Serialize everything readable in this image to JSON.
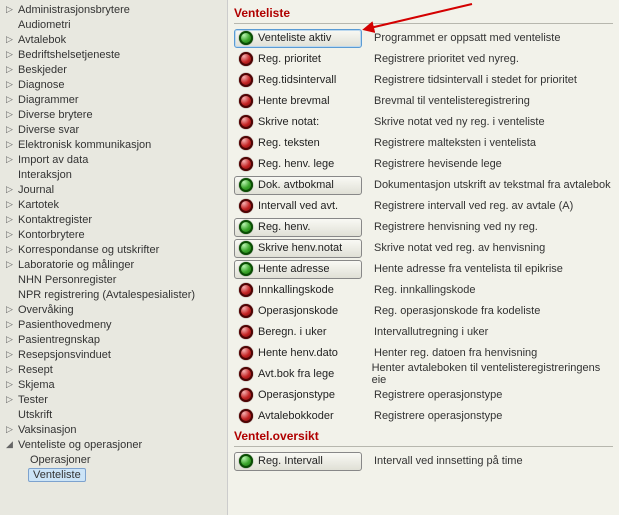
{
  "sidebar": {
    "items": [
      {
        "label": "Administrasjonsbrytere",
        "exp": "▷"
      },
      {
        "label": "Audiometri",
        "exp": ""
      },
      {
        "label": "Avtalebok",
        "exp": "▷"
      },
      {
        "label": "Bedriftshelsetjeneste",
        "exp": "▷"
      },
      {
        "label": "Beskjeder",
        "exp": "▷"
      },
      {
        "label": "Diagnose",
        "exp": "▷"
      },
      {
        "label": "Diagrammer",
        "exp": "▷"
      },
      {
        "label": "Diverse brytere",
        "exp": "▷"
      },
      {
        "label": "Diverse svar",
        "exp": "▷"
      },
      {
        "label": "Elektronisk kommunikasjon",
        "exp": "▷"
      },
      {
        "label": "Import av data",
        "exp": "▷"
      },
      {
        "label": "Interaksjon",
        "exp": ""
      },
      {
        "label": "Journal",
        "exp": "▷"
      },
      {
        "label": "Kartotek",
        "exp": "▷"
      },
      {
        "label": "Kontaktregister",
        "exp": "▷"
      },
      {
        "label": "Kontorbrytere",
        "exp": "▷"
      },
      {
        "label": "Korrespondanse og utskrifter",
        "exp": "▷"
      },
      {
        "label": "Laboratorie og målinger",
        "exp": "▷"
      },
      {
        "label": "NHN Personregister",
        "exp": ""
      },
      {
        "label": "NPR registrering (Avtalespesialister)",
        "exp": ""
      },
      {
        "label": "Overvåking",
        "exp": "▷"
      },
      {
        "label": "Pasienthovedmeny",
        "exp": "▷"
      },
      {
        "label": "Pasientregnskap",
        "exp": "▷"
      },
      {
        "label": "Resepsjonsvinduet",
        "exp": "▷"
      },
      {
        "label": "Resept",
        "exp": "▷"
      },
      {
        "label": "Skjema",
        "exp": "▷"
      },
      {
        "label": "Tester",
        "exp": "▷"
      },
      {
        "label": "Utskrift",
        "exp": ""
      },
      {
        "label": "Vaksinasjon",
        "exp": "▷"
      },
      {
        "label": "Venteliste og operasjoner",
        "exp": "◢",
        "expanded": true
      }
    ],
    "children": [
      {
        "label": "Operasjoner",
        "selected": false
      },
      {
        "label": "Venteliste",
        "selected": true
      }
    ]
  },
  "sections": [
    {
      "title": "Venteliste",
      "rows": [
        {
          "orb": "green",
          "framed": true,
          "active": true,
          "label": "Venteliste aktiv",
          "desc": "Programmet er oppsatt med venteliste"
        },
        {
          "orb": "red",
          "framed": false,
          "label": "Reg. prioritet",
          "desc": "Registrere prioritet ved nyreg."
        },
        {
          "orb": "red",
          "framed": false,
          "label": "Reg.tidsintervall",
          "desc": "Registrere tidsintervall i stedet for prioritet"
        },
        {
          "orb": "red",
          "framed": false,
          "label": "Hente brevmal",
          "desc": "Brevmal til ventelisteregistrering"
        },
        {
          "orb": "red",
          "framed": false,
          "label": "Skrive notat:",
          "desc": "Skrive notat ved ny reg. i venteliste"
        },
        {
          "orb": "red",
          "framed": false,
          "label": "Reg. teksten",
          "desc": "Registrere malteksten i ventelista"
        },
        {
          "orb": "red",
          "framed": false,
          "label": "Reg. henv. lege",
          "desc": "Registrere hevisende lege"
        },
        {
          "orb": "green",
          "framed": true,
          "label": "Dok. avtbokmal",
          "desc": "Dokumentasjon utskrift av tekstmal fra avtalebok"
        },
        {
          "orb": "red",
          "framed": false,
          "label": "Intervall ved avt.",
          "desc": "Registrere intervall ved reg. av avtale (A)"
        },
        {
          "orb": "green",
          "framed": true,
          "label": "Reg. henv.",
          "desc": "Registrere henvisning ved ny reg."
        },
        {
          "orb": "green",
          "framed": true,
          "label": "Skrive henv.notat",
          "desc": "Skrive notat ved reg. av henvisning"
        },
        {
          "orb": "green",
          "framed": true,
          "label": "Hente adresse",
          "desc": "Hente adresse fra ventelista til epikrise"
        },
        {
          "orb": "red",
          "framed": false,
          "label": "Innkallingskode",
          "desc": "Reg. innkallingskode"
        },
        {
          "orb": "red",
          "framed": false,
          "label": "Operasjonskode",
          "desc": "Reg. operasjonskode fra kodeliste"
        },
        {
          "orb": "red",
          "framed": false,
          "label": "Beregn. i uker",
          "desc": "Intervallutregning i uker"
        },
        {
          "orb": "red",
          "framed": false,
          "label": "Hente henv.dato",
          "desc": "Henter reg. datoen fra henvisning"
        },
        {
          "orb": "red",
          "framed": false,
          "label": "Avt.bok fra lege",
          "desc": "Henter avtaleboken til ventelisteregistreringens eie"
        },
        {
          "orb": "red",
          "framed": false,
          "label": "Operasjonstype",
          "desc": "Registrere operasjonstype"
        },
        {
          "orb": "red",
          "framed": false,
          "label": "Avtalebokkoder",
          "desc": "Registrere operasjonstype"
        }
      ]
    },
    {
      "title": "Ventel.oversikt",
      "rows": [
        {
          "orb": "green",
          "framed": true,
          "label": "Reg. Intervall",
          "desc": "Intervall ved innsetting på time"
        }
      ]
    }
  ]
}
